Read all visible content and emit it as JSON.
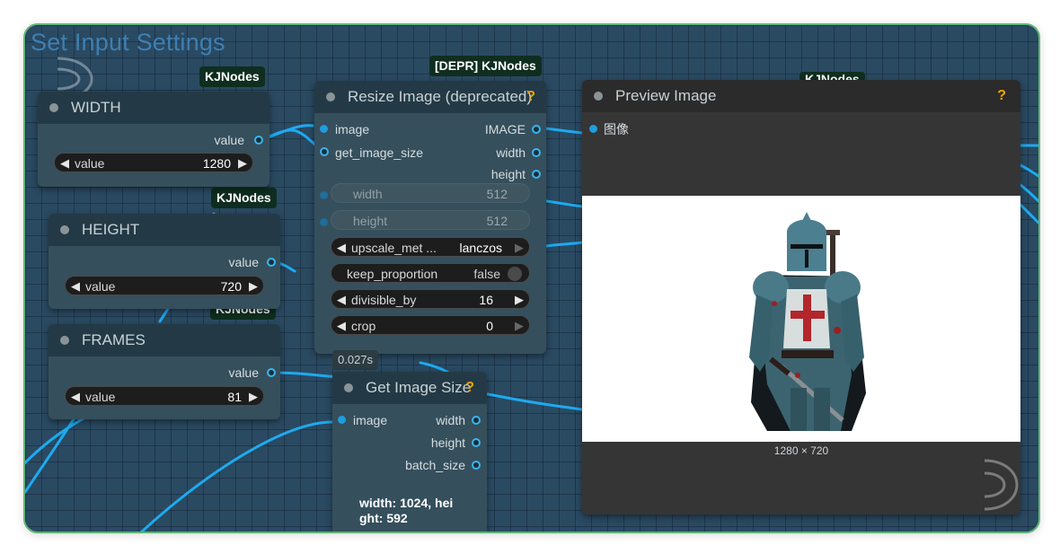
{
  "group": {
    "title": "Set Input Settings"
  },
  "badges": {
    "width_badge": "KJNodes",
    "height_badge": "KJNodes",
    "frames_badge": "KJNodes",
    "resize_badge": "[DEPR] KJNodes",
    "preview_badge": "KJNodes"
  },
  "width_node": {
    "title": "WIDTH",
    "output": "value",
    "widget_name": "value",
    "widget_value": "1280"
  },
  "height_node": {
    "title": "HEIGHT",
    "output": "value",
    "widget_name": "value",
    "widget_value": "720"
  },
  "frames_node": {
    "title": "FRAMES",
    "output": "value",
    "widget_name": "value",
    "widget_value": "81"
  },
  "resize_node": {
    "title": "Resize Image (deprecated)",
    "help": "?",
    "inputs": [
      "image",
      "get_image_size"
    ],
    "outputs": [
      "IMAGE",
      "width",
      "height"
    ],
    "widgets": {
      "width": {
        "name": "width",
        "value": "512"
      },
      "height": {
        "name": "height",
        "value": "512"
      },
      "upscale": {
        "name": "upscale_met ...",
        "value": "lanczos"
      },
      "keep": {
        "name": "keep_proportion",
        "value": "false"
      },
      "divisible": {
        "name": "divisible_by",
        "value": "16"
      },
      "crop": {
        "name": "crop",
        "value": "0"
      }
    },
    "timing": "0.027s"
  },
  "get_size_node": {
    "title": "Get Image Size",
    "help": "?",
    "input": "image",
    "outputs": [
      "width",
      "height",
      "batch_size"
    ],
    "info_line1": "width: 1024, hei",
    "info_line2": "ght: 592"
  },
  "preview_node": {
    "title": "Preview Image",
    "help": "?",
    "input": "图像",
    "dimensions": "1280 × 720"
  },
  "colors": {
    "wire": "#1eaaf0",
    "badge_bg": "#0f2e1f",
    "frame_border": "#5fb477",
    "help": "#f0a500"
  },
  "icons": [
    "watermark-logo-icon",
    "knight-image",
    "arrow-left-icon",
    "arrow-right-icon"
  ]
}
